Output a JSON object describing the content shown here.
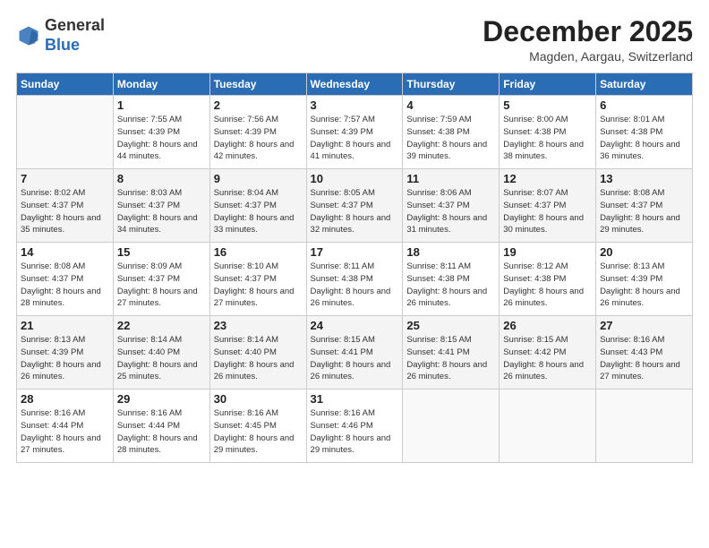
{
  "header": {
    "logo_general": "General",
    "logo_blue": "Blue",
    "month_title": "December 2025",
    "location": "Magden, Aargau, Switzerland"
  },
  "weekdays": [
    "Sunday",
    "Monday",
    "Tuesday",
    "Wednesday",
    "Thursday",
    "Friday",
    "Saturday"
  ],
  "weeks": [
    [
      {
        "day": "",
        "sunrise": "",
        "sunset": "",
        "daylight": ""
      },
      {
        "day": "1",
        "sunrise": "Sunrise: 7:55 AM",
        "sunset": "Sunset: 4:39 PM",
        "daylight": "Daylight: 8 hours and 44 minutes."
      },
      {
        "day": "2",
        "sunrise": "Sunrise: 7:56 AM",
        "sunset": "Sunset: 4:39 PM",
        "daylight": "Daylight: 8 hours and 42 minutes."
      },
      {
        "day": "3",
        "sunrise": "Sunrise: 7:57 AM",
        "sunset": "Sunset: 4:39 PM",
        "daylight": "Daylight: 8 hours and 41 minutes."
      },
      {
        "day": "4",
        "sunrise": "Sunrise: 7:59 AM",
        "sunset": "Sunset: 4:38 PM",
        "daylight": "Daylight: 8 hours and 39 minutes."
      },
      {
        "day": "5",
        "sunrise": "Sunrise: 8:00 AM",
        "sunset": "Sunset: 4:38 PM",
        "daylight": "Daylight: 8 hours and 38 minutes."
      },
      {
        "day": "6",
        "sunrise": "Sunrise: 8:01 AM",
        "sunset": "Sunset: 4:38 PM",
        "daylight": "Daylight: 8 hours and 36 minutes."
      }
    ],
    [
      {
        "day": "7",
        "sunrise": "Sunrise: 8:02 AM",
        "sunset": "Sunset: 4:37 PM",
        "daylight": "Daylight: 8 hours and 35 minutes."
      },
      {
        "day": "8",
        "sunrise": "Sunrise: 8:03 AM",
        "sunset": "Sunset: 4:37 PM",
        "daylight": "Daylight: 8 hours and 34 minutes."
      },
      {
        "day": "9",
        "sunrise": "Sunrise: 8:04 AM",
        "sunset": "Sunset: 4:37 PM",
        "daylight": "Daylight: 8 hours and 33 minutes."
      },
      {
        "day": "10",
        "sunrise": "Sunrise: 8:05 AM",
        "sunset": "Sunset: 4:37 PM",
        "daylight": "Daylight: 8 hours and 32 minutes."
      },
      {
        "day": "11",
        "sunrise": "Sunrise: 8:06 AM",
        "sunset": "Sunset: 4:37 PM",
        "daylight": "Daylight: 8 hours and 31 minutes."
      },
      {
        "day": "12",
        "sunrise": "Sunrise: 8:07 AM",
        "sunset": "Sunset: 4:37 PM",
        "daylight": "Daylight: 8 hours and 30 minutes."
      },
      {
        "day": "13",
        "sunrise": "Sunrise: 8:08 AM",
        "sunset": "Sunset: 4:37 PM",
        "daylight": "Daylight: 8 hours and 29 minutes."
      }
    ],
    [
      {
        "day": "14",
        "sunrise": "Sunrise: 8:08 AM",
        "sunset": "Sunset: 4:37 PM",
        "daylight": "Daylight: 8 hours and 28 minutes."
      },
      {
        "day": "15",
        "sunrise": "Sunrise: 8:09 AM",
        "sunset": "Sunset: 4:37 PM",
        "daylight": "Daylight: 8 hours and 27 minutes."
      },
      {
        "day": "16",
        "sunrise": "Sunrise: 8:10 AM",
        "sunset": "Sunset: 4:37 PM",
        "daylight": "Daylight: 8 hours and 27 minutes."
      },
      {
        "day": "17",
        "sunrise": "Sunrise: 8:11 AM",
        "sunset": "Sunset: 4:38 PM",
        "daylight": "Daylight: 8 hours and 26 minutes."
      },
      {
        "day": "18",
        "sunrise": "Sunrise: 8:11 AM",
        "sunset": "Sunset: 4:38 PM",
        "daylight": "Daylight: 8 hours and 26 minutes."
      },
      {
        "day": "19",
        "sunrise": "Sunrise: 8:12 AM",
        "sunset": "Sunset: 4:38 PM",
        "daylight": "Daylight: 8 hours and 26 minutes."
      },
      {
        "day": "20",
        "sunrise": "Sunrise: 8:13 AM",
        "sunset": "Sunset: 4:39 PM",
        "daylight": "Daylight: 8 hours and 26 minutes."
      }
    ],
    [
      {
        "day": "21",
        "sunrise": "Sunrise: 8:13 AM",
        "sunset": "Sunset: 4:39 PM",
        "daylight": "Daylight: 8 hours and 26 minutes."
      },
      {
        "day": "22",
        "sunrise": "Sunrise: 8:14 AM",
        "sunset": "Sunset: 4:40 PM",
        "daylight": "Daylight: 8 hours and 25 minutes."
      },
      {
        "day": "23",
        "sunrise": "Sunrise: 8:14 AM",
        "sunset": "Sunset: 4:40 PM",
        "daylight": "Daylight: 8 hours and 26 minutes."
      },
      {
        "day": "24",
        "sunrise": "Sunrise: 8:15 AM",
        "sunset": "Sunset: 4:41 PM",
        "daylight": "Daylight: 8 hours and 26 minutes."
      },
      {
        "day": "25",
        "sunrise": "Sunrise: 8:15 AM",
        "sunset": "Sunset: 4:41 PM",
        "daylight": "Daylight: 8 hours and 26 minutes."
      },
      {
        "day": "26",
        "sunrise": "Sunrise: 8:15 AM",
        "sunset": "Sunset: 4:42 PM",
        "daylight": "Daylight: 8 hours and 26 minutes."
      },
      {
        "day": "27",
        "sunrise": "Sunrise: 8:16 AM",
        "sunset": "Sunset: 4:43 PM",
        "daylight": "Daylight: 8 hours and 27 minutes."
      }
    ],
    [
      {
        "day": "28",
        "sunrise": "Sunrise: 8:16 AM",
        "sunset": "Sunset: 4:44 PM",
        "daylight": "Daylight: 8 hours and 27 minutes."
      },
      {
        "day": "29",
        "sunrise": "Sunrise: 8:16 AM",
        "sunset": "Sunset: 4:44 PM",
        "daylight": "Daylight: 8 hours and 28 minutes."
      },
      {
        "day": "30",
        "sunrise": "Sunrise: 8:16 AM",
        "sunset": "Sunset: 4:45 PM",
        "daylight": "Daylight: 8 hours and 29 minutes."
      },
      {
        "day": "31",
        "sunrise": "Sunrise: 8:16 AM",
        "sunset": "Sunset: 4:46 PM",
        "daylight": "Daylight: 8 hours and 29 minutes."
      },
      {
        "day": "",
        "sunrise": "",
        "sunset": "",
        "daylight": ""
      },
      {
        "day": "",
        "sunrise": "",
        "sunset": "",
        "daylight": ""
      },
      {
        "day": "",
        "sunrise": "",
        "sunset": "",
        "daylight": ""
      }
    ]
  ]
}
